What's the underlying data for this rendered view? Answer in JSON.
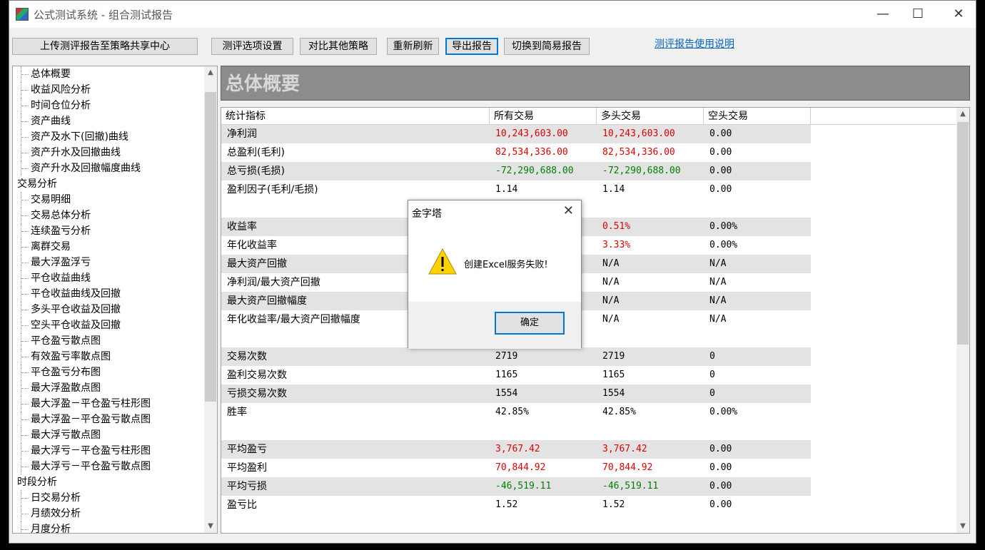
{
  "window": {
    "title": "公式测试系统 - 组合测试报告",
    "minimize": "—",
    "maximize": "☐",
    "close": "✕"
  },
  "toolbar": {
    "upload": "上传测评报告至策略共享中心",
    "options": "测评选项设置",
    "compare": "对比其他策略",
    "refresh": "重新刷新",
    "export": "导出报告",
    "simple": "切换到简易报告",
    "help_link": "测评报告使用说明"
  },
  "tree": [
    {
      "label": "总体概要",
      "level": 1
    },
    {
      "label": "收益风险分析",
      "level": 1
    },
    {
      "label": "时间仓位分析",
      "level": 1
    },
    {
      "label": "资产曲线",
      "level": 1
    },
    {
      "label": "资产及水下(回撤)曲线",
      "level": 1
    },
    {
      "label": "资产升水及回撤曲线",
      "level": 1
    },
    {
      "label": "资产升水及回撤幅度曲线",
      "level": 1
    },
    {
      "label": "交易分析",
      "level": 0
    },
    {
      "label": "交易明细",
      "level": 1
    },
    {
      "label": "交易总体分析",
      "level": 1
    },
    {
      "label": "连续盈亏分析",
      "level": 1
    },
    {
      "label": "离群交易",
      "level": 1
    },
    {
      "label": "最大浮盈浮亏",
      "level": 1
    },
    {
      "label": "平仓收益曲线",
      "level": 1
    },
    {
      "label": "平仓收益曲线及回撤",
      "level": 1
    },
    {
      "label": "多头平仓收益及回撤",
      "level": 1
    },
    {
      "label": "空头平仓收益及回撤",
      "level": 1
    },
    {
      "label": "平仓盈亏散点图",
      "level": 1
    },
    {
      "label": "有效盈亏率散点图",
      "level": 1
    },
    {
      "label": "平仓盈亏分布图",
      "level": 1
    },
    {
      "label": "最大浮盈散点图",
      "level": 1
    },
    {
      "label": "最大浮盈－平仓盈亏柱形图",
      "level": 1
    },
    {
      "label": "最大浮盈－平仓盈亏散点图",
      "level": 1
    },
    {
      "label": "最大浮亏散点图",
      "level": 1
    },
    {
      "label": "最大浮亏－平仓盈亏柱形图",
      "level": 1
    },
    {
      "label": "最大浮亏－平仓盈亏散点图",
      "level": 1
    },
    {
      "label": "时段分析",
      "level": 0
    },
    {
      "label": "日交易分析",
      "level": 1
    },
    {
      "label": "月绩效分析",
      "level": 1
    },
    {
      "label": "月度分析",
      "level": 1
    }
  ],
  "section_title": "总体概要",
  "table": {
    "headers": [
      "统计指标",
      "所有交易",
      "多头交易",
      "空头交易"
    ],
    "rows": [
      {
        "label": "净利润",
        "all": "10,243,603.00",
        "long": "10,243,603.00",
        "short": "0.00",
        "color": "red",
        "shade": true
      },
      {
        "label": "总盈利(毛利)",
        "all": "82,534,336.00",
        "long": "82,534,336.00",
        "short": "0.00",
        "color": "red",
        "shade": false
      },
      {
        "label": "总亏损(毛损)",
        "all": "-72,290,688.00",
        "long": "-72,290,688.00",
        "short": "0.00",
        "color": "green",
        "shade": true
      },
      {
        "label": "盈利因子(毛利/毛损)",
        "all": "1.14",
        "long": "1.14",
        "short": "0.00",
        "color": "",
        "shade": false
      },
      {
        "label": "",
        "all": "",
        "long": "",
        "short": "",
        "color": "",
        "shade": false
      },
      {
        "label": "收益率",
        "all": "",
        "long": "0.51%",
        "short": "0.00%",
        "color": "red",
        "shade": true
      },
      {
        "label": "年化收益率",
        "all": "",
        "long": "3.33%",
        "short": "0.00%",
        "color": "red",
        "shade": false
      },
      {
        "label": "最大资产回撤",
        "all": "",
        "long": "N/A",
        "short": "N/A",
        "color": "",
        "shade": true
      },
      {
        "label": "净利润/最大资产回撤",
        "all": "",
        "long": "N/A",
        "short": "N/A",
        "color": "",
        "shade": false
      },
      {
        "label": "最大资产回撤幅度",
        "all": "",
        "long": "N/A",
        "short": "N/A",
        "color": "",
        "shade": true
      },
      {
        "label": "年化收益率/最大资产回撤幅度",
        "all": "",
        "long": "N/A",
        "short": "N/A",
        "color": "",
        "shade": false
      },
      {
        "label": "",
        "all": "",
        "long": "",
        "short": "",
        "color": "",
        "shade": false
      },
      {
        "label": "交易次数",
        "all": "2719",
        "long": "2719",
        "short": "0",
        "color": "",
        "shade": true
      },
      {
        "label": "盈利交易次数",
        "all": "1165",
        "long": "1165",
        "short": "0",
        "color": "",
        "shade": false
      },
      {
        "label": "亏损交易次数",
        "all": "1554",
        "long": "1554",
        "short": "0",
        "color": "",
        "shade": true
      },
      {
        "label": "胜率",
        "all": "42.85%",
        "long": "42.85%",
        "short": "0.00%",
        "color": "",
        "shade": false
      },
      {
        "label": "",
        "all": "",
        "long": "",
        "short": "",
        "color": "",
        "shade": false
      },
      {
        "label": "平均盈亏",
        "all": "3,767.42",
        "long": "3,767.42",
        "short": "0.00",
        "color": "red",
        "shade": true
      },
      {
        "label": "平均盈利",
        "all": "70,844.92",
        "long": "70,844.92",
        "short": "0.00",
        "color": "red",
        "shade": false
      },
      {
        "label": "平均亏损",
        "all": "-46,519.11",
        "long": "-46,519.11",
        "short": "0.00",
        "color": "green",
        "shade": true
      },
      {
        "label": "盈亏比",
        "all": "1.52",
        "long": "1.52",
        "short": "0.00",
        "color": "",
        "shade": false
      }
    ]
  },
  "dialog": {
    "title": "金字塔",
    "close": "✕",
    "message": "创建Excel服务失败!",
    "ok": "确定",
    "icon": "warning-icon"
  }
}
